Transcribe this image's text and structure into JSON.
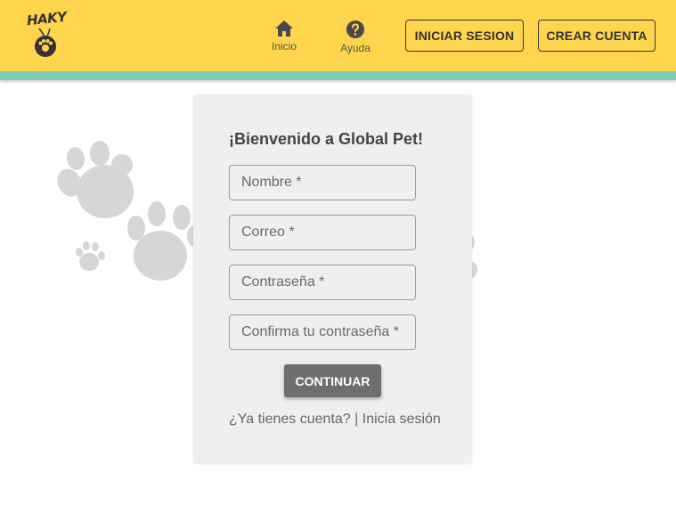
{
  "header": {
    "logo_text": "HAKY",
    "nav": [
      {
        "label": "Inicio",
        "icon": "home-icon"
      },
      {
        "label": "Ayuda",
        "icon": "help-circle-icon"
      }
    ],
    "login_button": "INICIAR SESION",
    "signup_button": "CREAR CUENTA",
    "colors": {
      "bar": "#fed54d",
      "stripe": "#7ecdbb"
    }
  },
  "form": {
    "title": "¡Bienvenido a Global Pet!",
    "fields": [
      {
        "placeholder": "Nombre *"
      },
      {
        "placeholder": "Correo *"
      },
      {
        "placeholder": "Contraseña *"
      },
      {
        "placeholder": "Confirma tu contraseña *"
      }
    ],
    "submit_label": "CONTINUAR",
    "login_prompt": "¿Ya tienes cuenta?",
    "separator": "|",
    "login_link": "Inicia sesión"
  }
}
